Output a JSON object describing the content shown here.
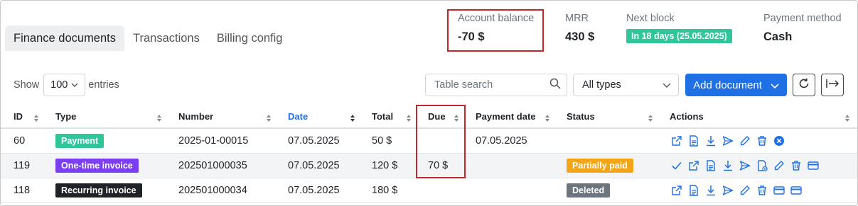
{
  "tabs": [
    {
      "label": "Finance documents",
      "active": true
    },
    {
      "label": "Transactions",
      "active": false
    },
    {
      "label": "Billing config",
      "active": false
    }
  ],
  "stats": {
    "account_balance": {
      "label": "Account balance",
      "value": "-70 $"
    },
    "mrr": {
      "label": "MRR",
      "value": "430 $"
    },
    "next_block": {
      "label": "Next block",
      "value": "In 18 days (25.05.2025)"
    },
    "payment_method": {
      "label": "Payment method",
      "value": "Cash"
    }
  },
  "controls": {
    "show_label": "Show",
    "entries_value": "100",
    "entries_label": "entries",
    "search_placeholder": "Table search",
    "type_filter_value": "All types",
    "add_button_label": "Add document"
  },
  "table": {
    "headers": [
      "ID",
      "Type",
      "Number",
      "Date",
      "Total",
      "Due",
      "Payment date",
      "Status",
      "Actions"
    ],
    "rows": [
      {
        "id": "60",
        "type": "Payment",
        "type_color": "#2ec69a",
        "number": "2025-01-00015",
        "date": "07.05.2025",
        "total": "50 $",
        "due": "",
        "payment_date": "07.05.2025",
        "status": "",
        "status_color": "",
        "actions": [
          "open-external-icon",
          "document-icon",
          "download-icon",
          "send-icon",
          "edit-icon",
          "delete-icon",
          "cancel-circle-icon"
        ]
      },
      {
        "id": "119",
        "type": "One-time invoice",
        "type_color": "#7a3ff0",
        "number": "202501000035",
        "date": "07.05.2025",
        "total": "120 $",
        "due": "70 $",
        "payment_date": "",
        "status": "Partially paid",
        "status_color": "#f2a517",
        "actions": [
          "check-icon",
          "open-external-icon",
          "document-icon",
          "download-icon",
          "send-icon",
          "credit-note-icon",
          "edit-icon",
          "delete-icon",
          "credit-card-icon"
        ]
      },
      {
        "id": "118",
        "type": "Recurring invoice",
        "type_color": "#1f2226",
        "number": "202501000034",
        "date": "07.05.2025",
        "total": "180 $",
        "due": "",
        "payment_date": "",
        "status": "Deleted",
        "status_color": "#6c757d",
        "actions": [
          "open-external-icon",
          "document-icon",
          "download-icon",
          "send-icon",
          "edit-icon",
          "delete-icon",
          "credit-card-icon",
          "credit-card-icon"
        ]
      }
    ]
  },
  "colors": {
    "accent": "#1f6fe5",
    "highlight_box": "#c0262b",
    "icon": "#1f6fe5"
  }
}
